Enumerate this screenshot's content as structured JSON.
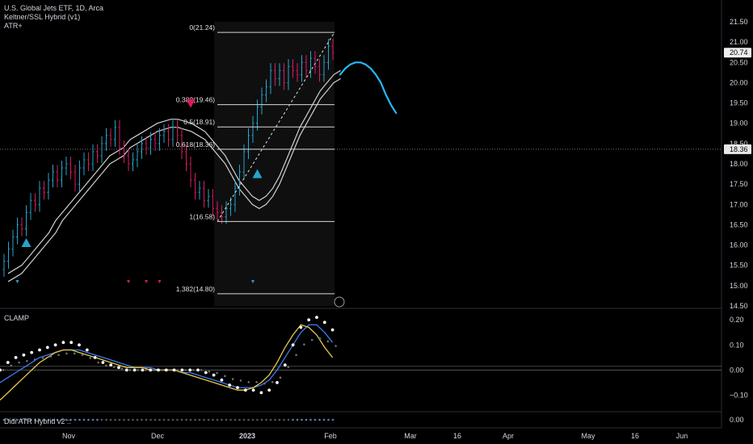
{
  "legend": {
    "symbol_title": "U.S. Global Jets ETF, 1D, Arca",
    "indicator1": "Keltner/SSL Hybrid (v1)",
    "indicator2": "ATR+",
    "clamp": "CLAMP",
    "didi": "Didi ATR Hybrid v2 ::"
  },
  "colors": {
    "background": "#000000",
    "up": "#26a5c9",
    "down": "#d81b60",
    "channel": "#d0d0d0",
    "projection": "#29b6f6",
    "clamp_dots": "#ffffff",
    "clamp_gray": "#6e6e6e",
    "clamp_yellow": "#e6c84d",
    "clamp_blue": "#3d7df0",
    "axis_text": "#d1d4dc",
    "price_tag_bg": "#eeeeee",
    "crosshair_tag_bg": "#e8e8e8"
  },
  "chart_data": [
    {
      "type": "candlestick",
      "panel": "main",
      "y_axis_ticks": [
        "21.50",
        "21.00",
        "20.50",
        "20.00",
        "19.50",
        "19.00",
        "18.50",
        "18.00",
        "17.50",
        "17.00",
        "16.50",
        "16.00",
        "15.50",
        "15.00",
        "14.50"
      ],
      "ylim": [
        14.5,
        21.5
      ],
      "last_price_label": "20.74",
      "last_price": 20.74,
      "crosshair_label": "18.36",
      "crosshair_value": 18.36,
      "ohlc_close": [
        15.6,
        15.9,
        16.2,
        16.5,
        16.4,
        16.8,
        17.1,
        17.0,
        17.4,
        17.3,
        17.6,
        17.8,
        17.6,
        17.9,
        18.0,
        17.8,
        17.5,
        17.9,
        18.1,
        18.0,
        18.3,
        18.2,
        18.5,
        18.7,
        18.6,
        18.9,
        18.4,
        18.2,
        18.0,
        18.1,
        18.3,
        18.5,
        18.4,
        18.6,
        18.5,
        18.7,
        18.8,
        18.6,
        18.9,
        18.7,
        18.3,
        18.0,
        17.6,
        17.3,
        17.4,
        17.1,
        17.2,
        16.9,
        16.8,
        16.7,
        16.9,
        17.0,
        17.4,
        17.8,
        18.3,
        18.7,
        19.0,
        19.4,
        19.7,
        19.9,
        20.3,
        20.1,
        20.3,
        20.0,
        20.4,
        20.3,
        20.2,
        20.5,
        20.3,
        20.6,
        20.4,
        20.2,
        20.5,
        20.9,
        20.74
      ],
      "ohlc_dir": [
        1,
        1,
        1,
        1,
        0,
        1,
        1,
        0,
        1,
        0,
        1,
        1,
        0,
        1,
        1,
        0,
        0,
        1,
        1,
        0,
        1,
        0,
        1,
        1,
        0,
        1,
        0,
        0,
        0,
        1,
        1,
        1,
        0,
        1,
        0,
        1,
        1,
        0,
        1,
        0,
        0,
        0,
        0,
        0,
        1,
        0,
        1,
        0,
        0,
        0,
        1,
        1,
        1,
        1,
        1,
        1,
        1,
        1,
        1,
        1,
        1,
        0,
        1,
        0,
        1,
        0,
        0,
        1,
        0,
        1,
        0,
        0,
        1,
        1,
        0
      ],
      "keltner_upper": [
        15.3,
        15.4,
        15.5,
        15.7,
        15.9,
        16.1,
        16.3,
        16.6,
        16.8,
        17.0,
        17.2,
        17.4,
        17.6,
        17.8,
        18.0,
        18.2,
        18.3,
        18.4,
        18.6,
        18.7,
        18.8,
        18.9,
        19.0,
        19.05,
        19.1,
        19.1,
        19.05,
        19.0,
        18.9,
        18.8,
        18.6,
        18.4,
        18.2,
        17.9,
        17.6,
        17.4,
        17.2,
        17.1,
        17.2,
        17.4,
        17.7,
        18.1,
        18.5,
        18.9,
        19.2,
        19.5,
        19.8,
        20.0,
        20.2,
        20.3
      ],
      "keltner_lower": [
        15.1,
        15.2,
        15.3,
        15.5,
        15.7,
        15.9,
        16.1,
        16.3,
        16.6,
        16.8,
        17.0,
        17.2,
        17.4,
        17.6,
        17.8,
        18.0,
        18.1,
        18.2,
        18.4,
        18.5,
        18.6,
        18.7,
        18.8,
        18.85,
        18.9,
        18.9,
        18.85,
        18.8,
        18.7,
        18.6,
        18.4,
        18.2,
        18.0,
        17.7,
        17.4,
        17.2,
        17.0,
        16.9,
        17.0,
        17.2,
        17.5,
        17.9,
        18.3,
        18.7,
        19.0,
        19.3,
        19.6,
        19.8,
        20.0,
        20.1
      ],
      "fibonacci": [
        {
          "label": "0(21.24)",
          "value": 21.24
        },
        {
          "label": "0.382(19.46)",
          "value": 19.46
        },
        {
          "label": "0.5(18.91)",
          "value": 18.91
        },
        {
          "label": "0.618(18.36)",
          "value": 18.36
        },
        {
          "label": "1(16.58)",
          "value": 16.58
        },
        {
          "label": "1.382(14.80)",
          "value": 14.8
        }
      ],
      "fib_swing": {
        "low": 16.58,
        "high": 21.24
      },
      "projection_curve": [
        20.2,
        20.35,
        20.45,
        20.5,
        20.5,
        20.45,
        20.35,
        20.2,
        20.0,
        19.7,
        19.45,
        19.25
      ],
      "signals": [
        {
          "type": "buy",
          "value": 16.05
        },
        {
          "type": "sell",
          "value": 19.5
        },
        {
          "type": "buy",
          "value": 17.75
        }
      ]
    },
    {
      "type": "line",
      "panel": "CLAMP",
      "y_axis_ticks": [
        "0.20",
        "0.10",
        "0.00",
        "−0.10"
      ],
      "ylim": [
        -0.15,
        0.22
      ],
      "series_dots": [
        0.0,
        0.03,
        0.05,
        0.06,
        0.07,
        0.08,
        0.09,
        0.1,
        0.11,
        0.11,
        0.1,
        0.08,
        0.05,
        0.03,
        0.02,
        0.01,
        0.0,
        0.0,
        0.0,
        0.0,
        0.0,
        0.0,
        0.0,
        0.0,
        0.0,
        0.0,
        -0.01,
        -0.02,
        -0.04,
        -0.06,
        -0.07,
        -0.08,
        -0.08,
        -0.09,
        -0.08,
        -0.05,
        0.02,
        0.1,
        0.17,
        0.2,
        0.21,
        0.19,
        0.16
      ],
      "series_yellow": [
        -0.12,
        -0.09,
        -0.06,
        -0.03,
        0.0,
        0.03,
        0.05,
        0.07,
        0.08,
        0.08,
        0.07,
        0.06,
        0.05,
        0.04,
        0.03,
        0.02,
        0.01,
        0.01,
        0.01,
        0.0,
        0.0,
        0.0,
        0.0,
        -0.01,
        -0.02,
        -0.03,
        -0.04,
        -0.05,
        -0.06,
        -0.07,
        -0.08,
        -0.08,
        -0.07,
        -0.05,
        -0.02,
        0.03,
        0.09,
        0.14,
        0.18,
        0.17,
        0.14,
        0.09,
        0.05
      ],
      "series_blue": [
        -0.05,
        -0.03,
        -0.01,
        0.01,
        0.03,
        0.05,
        0.06,
        0.07,
        0.08,
        0.08,
        0.08,
        0.07,
        0.06,
        0.05,
        0.04,
        0.03,
        0.02,
        0.01,
        0.01,
        0.01,
        0.0,
        0.0,
        0.0,
        -0.01,
        -0.01,
        -0.02,
        -0.03,
        -0.04,
        -0.05,
        -0.06,
        -0.07,
        -0.07,
        -0.07,
        -0.06,
        -0.04,
        0.0,
        0.05,
        0.1,
        0.15,
        0.18,
        0.18,
        0.15,
        0.11
      ]
    },
    {
      "type": "scatter",
      "panel": "Didi ATR Hybrid v2",
      "y_axis_ticks": [
        "0.00"
      ],
      "ylim": [
        0,
        0
      ],
      "values": [
        0.0
      ]
    }
  ],
  "x_axis": {
    "labels": [
      "Nov",
      "Dec",
      "2023",
      "Feb",
      "Mar",
      "16",
      "Apr",
      "May",
      "16",
      "Jun"
    ]
  }
}
